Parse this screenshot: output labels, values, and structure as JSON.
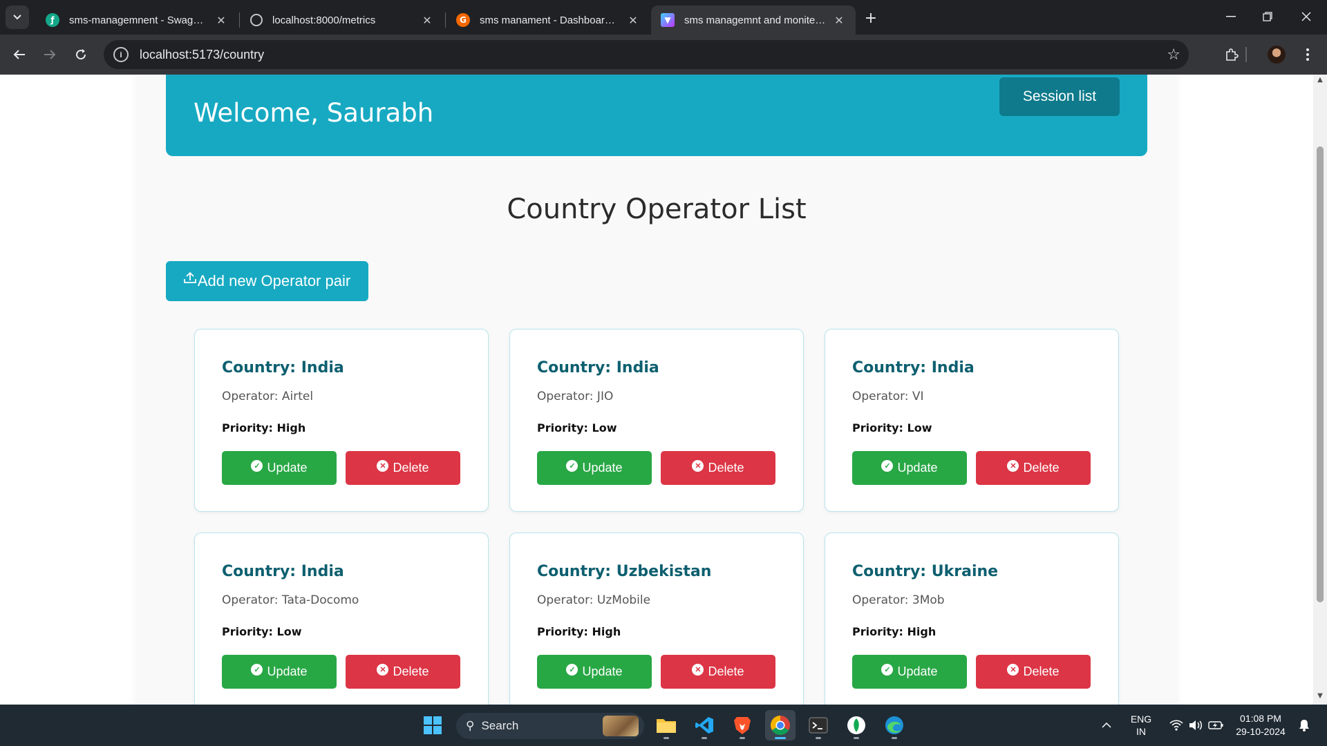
{
  "browser": {
    "tabs": [
      {
        "title": "sms-managemnent - Swagger UI",
        "favicon": "swagger-icon",
        "active": false
      },
      {
        "title": "localhost:8000/metrics",
        "favicon": "globe-icon",
        "active": false
      },
      {
        "title": "sms manament - Dashboards - Grafana",
        "favicon": "grafana-icon",
        "active": false
      },
      {
        "title": "sms managemnt and monitering",
        "favicon": "vite-icon",
        "active": true
      }
    ],
    "url": "localhost:5173/country"
  },
  "header": {
    "welcome": "Welcome, Saurabh",
    "session_button": "Session list"
  },
  "page": {
    "title": "Country Operator List",
    "add_button": "Add new Operator pair"
  },
  "cards": [
    {
      "country": "Country: India",
      "operator": "Operator: Airtel",
      "priority": "Priority: High",
      "update": "Update",
      "delete": "Delete"
    },
    {
      "country": "Country: India",
      "operator": "Operator: JIO",
      "priority": "Priority: Low",
      "update": "Update",
      "delete": "Delete"
    },
    {
      "country": "Country: India",
      "operator": "Operator: VI",
      "priority": "Priority: Low",
      "update": "Update",
      "delete": "Delete"
    },
    {
      "country": "Country: India",
      "operator": "Operator: Tata-Docomo",
      "priority": "Priority: Low",
      "update": "Update",
      "delete": "Delete"
    },
    {
      "country": "Country: Uzbekistan",
      "operator": "Operator: UzMobile",
      "priority": "Priority: High",
      "update": "Update",
      "delete": "Delete"
    },
    {
      "country": "Country: Ukraine",
      "operator": "Operator: 3Mob",
      "priority": "Priority: High",
      "update": "Update",
      "delete": "Delete"
    }
  ],
  "taskbar": {
    "search_placeholder": "Search",
    "language": "ENG",
    "region": "IN",
    "time": "01:08 PM",
    "date": "29-10-2024"
  },
  "colors": {
    "accent": "#17a9c2",
    "accent_dark": "#0e7a8c",
    "update": "#28a745",
    "delete": "#dc3545",
    "card_title": "#0d5f6f"
  }
}
